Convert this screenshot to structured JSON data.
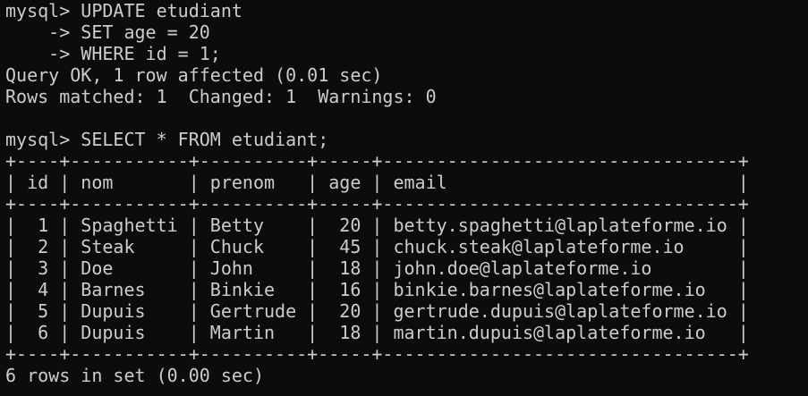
{
  "terminal": {
    "lines": [
      "mysql> UPDATE etudiant",
      "    -> SET age = 20",
      "    -> WHERE id = 1;",
      "Query OK, 1 row affected (0.01 sec)",
      "Rows matched: 1  Changed: 1  Warnings: 0",
      "",
      "mysql> SELECT * FROM etudiant;",
      "+----+-----------+----------+-----+---------------------------------+",
      "| id | nom       | prenom   | age | email                           |",
      "+----+-----------+----------+-----+---------------------------------+",
      "|  1 | Spaghetti | Betty    |  20 | betty.spaghetti@laplateforme.io |",
      "|  2 | Steak     | Chuck    |  45 | chuck.steak@laplateforme.io     |",
      "|  3 | Doe       | John     |  18 | john.doe@laplateforme.io        |",
      "|  4 | Barnes    | Binkie   |  16 | binkie.barnes@laplateforme.io   |",
      "|  5 | Dupuis    | Gertrude |  20 | gertrude.dupuis@laplateforme.io |",
      "|  6 | Dupuis    | Martin   |  18 | martin.dupuis@laplateforme.io   |",
      "+----+-----------+----------+-----+---------------------------------+",
      "6 rows in set (0.00 sec)"
    ]
  }
}
